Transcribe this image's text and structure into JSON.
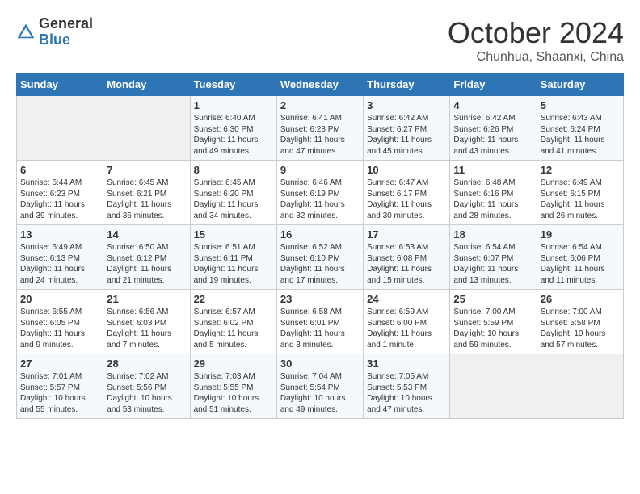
{
  "header": {
    "logo_general": "General",
    "logo_blue": "Blue",
    "title": "October 2024",
    "subtitle": "Chunhua, Shaanxi, China"
  },
  "columns": [
    "Sunday",
    "Monday",
    "Tuesday",
    "Wednesday",
    "Thursday",
    "Friday",
    "Saturday"
  ],
  "weeks": [
    [
      {
        "day": "",
        "info": ""
      },
      {
        "day": "",
        "info": ""
      },
      {
        "day": "1",
        "info": "Sunrise: 6:40 AM\nSunset: 6:30 PM\nDaylight: 11 hours and 49 minutes."
      },
      {
        "day": "2",
        "info": "Sunrise: 6:41 AM\nSunset: 6:28 PM\nDaylight: 11 hours and 47 minutes."
      },
      {
        "day": "3",
        "info": "Sunrise: 6:42 AM\nSunset: 6:27 PM\nDaylight: 11 hours and 45 minutes."
      },
      {
        "day": "4",
        "info": "Sunrise: 6:42 AM\nSunset: 6:26 PM\nDaylight: 11 hours and 43 minutes."
      },
      {
        "day": "5",
        "info": "Sunrise: 6:43 AM\nSunset: 6:24 PM\nDaylight: 11 hours and 41 minutes."
      }
    ],
    [
      {
        "day": "6",
        "info": "Sunrise: 6:44 AM\nSunset: 6:23 PM\nDaylight: 11 hours and 39 minutes."
      },
      {
        "day": "7",
        "info": "Sunrise: 6:45 AM\nSunset: 6:21 PM\nDaylight: 11 hours and 36 minutes."
      },
      {
        "day": "8",
        "info": "Sunrise: 6:45 AM\nSunset: 6:20 PM\nDaylight: 11 hours and 34 minutes."
      },
      {
        "day": "9",
        "info": "Sunrise: 6:46 AM\nSunset: 6:19 PM\nDaylight: 11 hours and 32 minutes."
      },
      {
        "day": "10",
        "info": "Sunrise: 6:47 AM\nSunset: 6:17 PM\nDaylight: 11 hours and 30 minutes."
      },
      {
        "day": "11",
        "info": "Sunrise: 6:48 AM\nSunset: 6:16 PM\nDaylight: 11 hours and 28 minutes."
      },
      {
        "day": "12",
        "info": "Sunrise: 6:49 AM\nSunset: 6:15 PM\nDaylight: 11 hours and 26 minutes."
      }
    ],
    [
      {
        "day": "13",
        "info": "Sunrise: 6:49 AM\nSunset: 6:13 PM\nDaylight: 11 hours and 24 minutes."
      },
      {
        "day": "14",
        "info": "Sunrise: 6:50 AM\nSunset: 6:12 PM\nDaylight: 11 hours and 21 minutes."
      },
      {
        "day": "15",
        "info": "Sunrise: 6:51 AM\nSunset: 6:11 PM\nDaylight: 11 hours and 19 minutes."
      },
      {
        "day": "16",
        "info": "Sunrise: 6:52 AM\nSunset: 6:10 PM\nDaylight: 11 hours and 17 minutes."
      },
      {
        "day": "17",
        "info": "Sunrise: 6:53 AM\nSunset: 6:08 PM\nDaylight: 11 hours and 15 minutes."
      },
      {
        "day": "18",
        "info": "Sunrise: 6:54 AM\nSunset: 6:07 PM\nDaylight: 11 hours and 13 minutes."
      },
      {
        "day": "19",
        "info": "Sunrise: 6:54 AM\nSunset: 6:06 PM\nDaylight: 11 hours and 11 minutes."
      }
    ],
    [
      {
        "day": "20",
        "info": "Sunrise: 6:55 AM\nSunset: 6:05 PM\nDaylight: 11 hours and 9 minutes."
      },
      {
        "day": "21",
        "info": "Sunrise: 6:56 AM\nSunset: 6:03 PM\nDaylight: 11 hours and 7 minutes."
      },
      {
        "day": "22",
        "info": "Sunrise: 6:57 AM\nSunset: 6:02 PM\nDaylight: 11 hours and 5 minutes."
      },
      {
        "day": "23",
        "info": "Sunrise: 6:58 AM\nSunset: 6:01 PM\nDaylight: 11 hours and 3 minutes."
      },
      {
        "day": "24",
        "info": "Sunrise: 6:59 AM\nSunset: 6:00 PM\nDaylight: 11 hours and 1 minute."
      },
      {
        "day": "25",
        "info": "Sunrise: 7:00 AM\nSunset: 5:59 PM\nDaylight: 10 hours and 59 minutes."
      },
      {
        "day": "26",
        "info": "Sunrise: 7:00 AM\nSunset: 5:58 PM\nDaylight: 10 hours and 57 minutes."
      }
    ],
    [
      {
        "day": "27",
        "info": "Sunrise: 7:01 AM\nSunset: 5:57 PM\nDaylight: 10 hours and 55 minutes."
      },
      {
        "day": "28",
        "info": "Sunrise: 7:02 AM\nSunset: 5:56 PM\nDaylight: 10 hours and 53 minutes."
      },
      {
        "day": "29",
        "info": "Sunrise: 7:03 AM\nSunset: 5:55 PM\nDaylight: 10 hours and 51 minutes."
      },
      {
        "day": "30",
        "info": "Sunrise: 7:04 AM\nSunset: 5:54 PM\nDaylight: 10 hours and 49 minutes."
      },
      {
        "day": "31",
        "info": "Sunrise: 7:05 AM\nSunset: 5:53 PM\nDaylight: 10 hours and 47 minutes."
      },
      {
        "day": "",
        "info": ""
      },
      {
        "day": "",
        "info": ""
      }
    ]
  ]
}
